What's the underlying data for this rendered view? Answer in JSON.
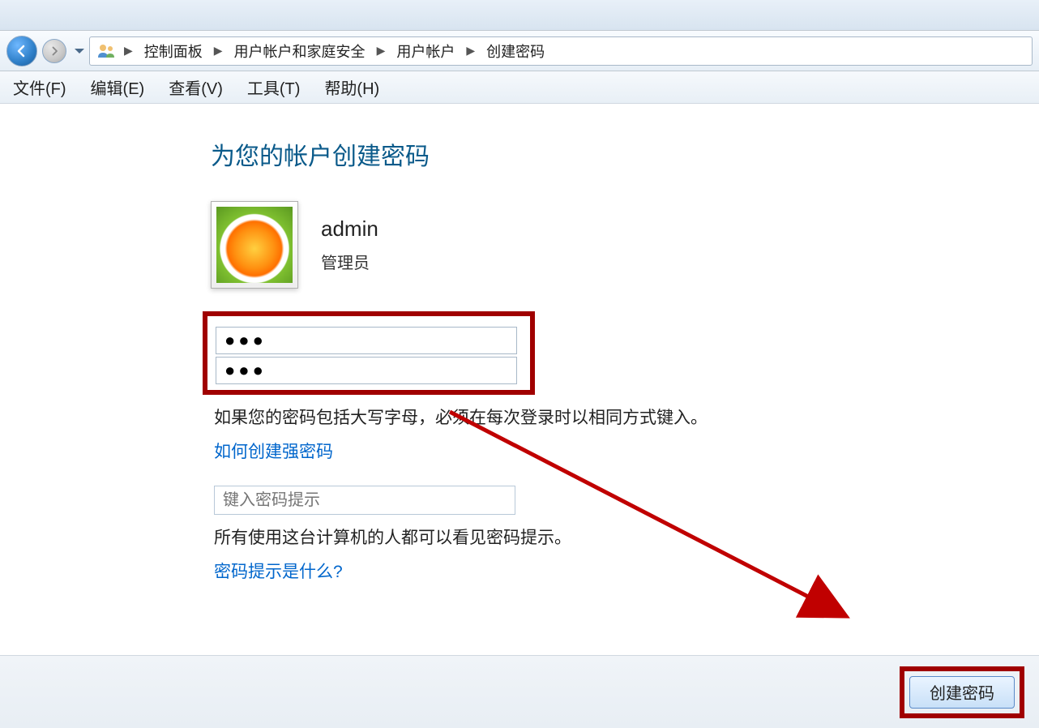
{
  "breadcrumb": {
    "items": [
      "控制面板",
      "用户帐户和家庭安全",
      "用户帐户",
      "创建密码"
    ]
  },
  "menubar": {
    "file": "文件(F)",
    "edit": "编辑(E)",
    "view": "查看(V)",
    "tools": "工具(T)",
    "help": "帮助(H)"
  },
  "page": {
    "title": "为您的帐户创建密码"
  },
  "user": {
    "name": "admin",
    "role": "管理员"
  },
  "password_section": {
    "password_value": "●●●",
    "confirm_value": "●●●",
    "caps_note": "如果您的密码包括大写字母，必须在每次登录时以相同方式键入。",
    "strong_link": "如何创建强密码"
  },
  "hint_section": {
    "placeholder": "键入密码提示",
    "visibility_note": "所有使用这台计算机的人都可以看见密码提示。",
    "what_is_link": "密码提示是什么?"
  },
  "footer": {
    "create_button": "创建密码"
  }
}
